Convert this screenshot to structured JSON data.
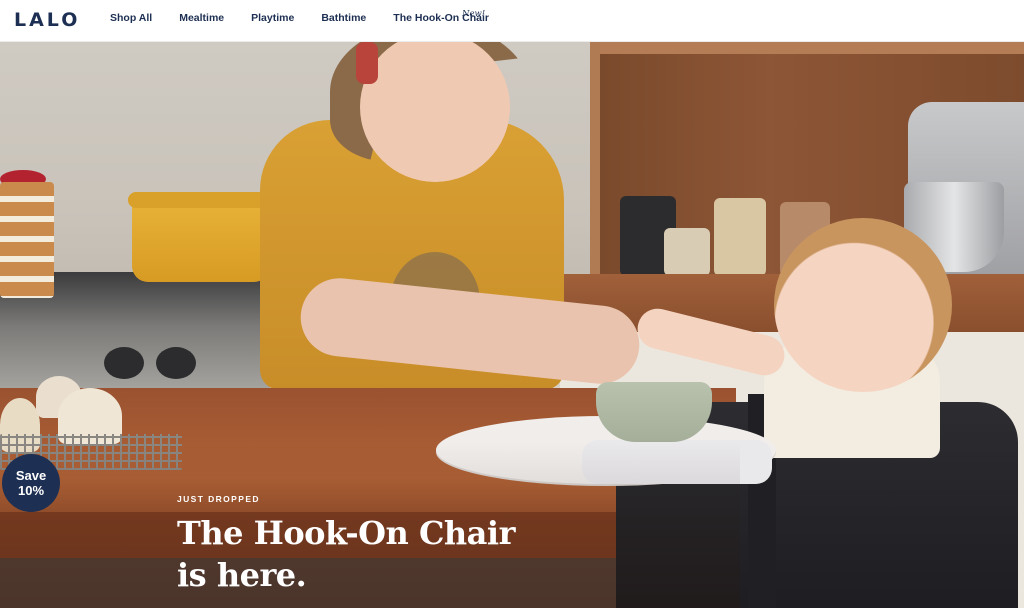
{
  "brand": {
    "logo_text": "LALO"
  },
  "nav": {
    "items": [
      {
        "label": "Shop All"
      },
      {
        "label": "Mealtime"
      },
      {
        "label": "Playtime"
      },
      {
        "label": "Bathtime"
      },
      {
        "label": "The Hook-On Chair"
      }
    ],
    "new_badge": "New!"
  },
  "hero": {
    "eyebrow": "JUST DROPPED",
    "headline_line1": "The Hook-On Chair",
    "headline_line2": "is here.",
    "image_icon": "hero-photo-kitchen-mom-baby-hook-on-chair"
  },
  "promo": {
    "line1": "Save",
    "line2": "10%"
  },
  "colors": {
    "brand_navy": "#1d2f52",
    "header_bg": "#ffffff",
    "headline_text": "#ffffff"
  }
}
